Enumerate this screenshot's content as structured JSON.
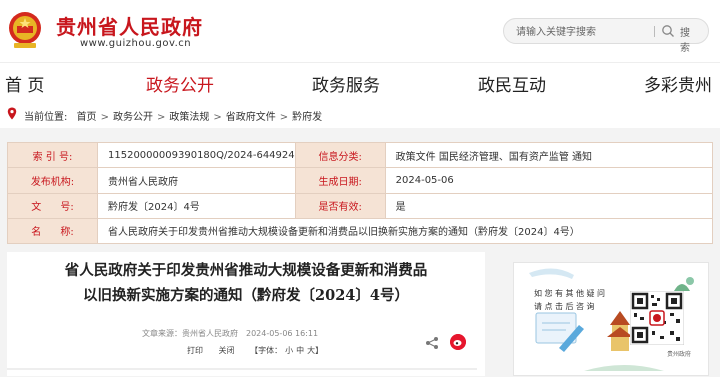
{
  "site": {
    "title": "贵州省人民政府",
    "url": "www.guizhou.gov.cn"
  },
  "search": {
    "placeholder": "请输入关键字搜索",
    "button_label": "搜 索"
  },
  "nav": {
    "items": [
      {
        "label": "首 页",
        "active": false
      },
      {
        "label": "政务公开",
        "active": true
      },
      {
        "label": "政务服务",
        "active": false
      },
      {
        "label": "政民互动",
        "active": false
      },
      {
        "label": "多彩贵州",
        "active": false
      }
    ]
  },
  "breadcrumb": {
    "prefix": "当前位置:",
    "items": [
      "首页",
      "政务公开",
      "政策法规",
      "省政府文件",
      "黔府发"
    ],
    "separator": ">"
  },
  "info": {
    "index_label": "索 引 号:",
    "index_value": "11520000009390180Q/2024-644924",
    "category_label": "信息分类:",
    "category_value": "政策文件   国民经济管理、国有资产监管   通知",
    "issuer_label": "发布机构:",
    "issuer_value": "贵州省人民政府",
    "date_label": "生成日期:",
    "date_value": "2024-05-06",
    "docno_label": "文      号:",
    "docno_value": "黔府发〔2024〕4号",
    "valid_label": "是否有效:",
    "valid_value": "是",
    "name_label": "名      称:",
    "name_value": "省人民政府关于印发贵州省推动大规模设备更新和消费品以旧换新实施方案的通知（黔府发〔2024〕4号）"
  },
  "article": {
    "title_line1": "省人民政府关于印发贵州省推动大规模设备更新和消费品",
    "title_line2": "以旧换新实施方案的通知（黔府发〔2024〕4号）",
    "source": "文章来源：贵州省人民政府",
    "time": "2024-05-06 16:11",
    "print_label": "打印",
    "close_label": "关闭",
    "font_label": "【字体：",
    "font_small": "小",
    "font_medium": "中",
    "font_large": "大】"
  },
  "sidebar": {
    "line1": "如您有其他疑问",
    "line2": "请点击后咨询",
    "qr_caption": "贵州政府"
  },
  "colors": {
    "brand_red": "#c8161d",
    "label_bg": "#f5e3d5"
  }
}
